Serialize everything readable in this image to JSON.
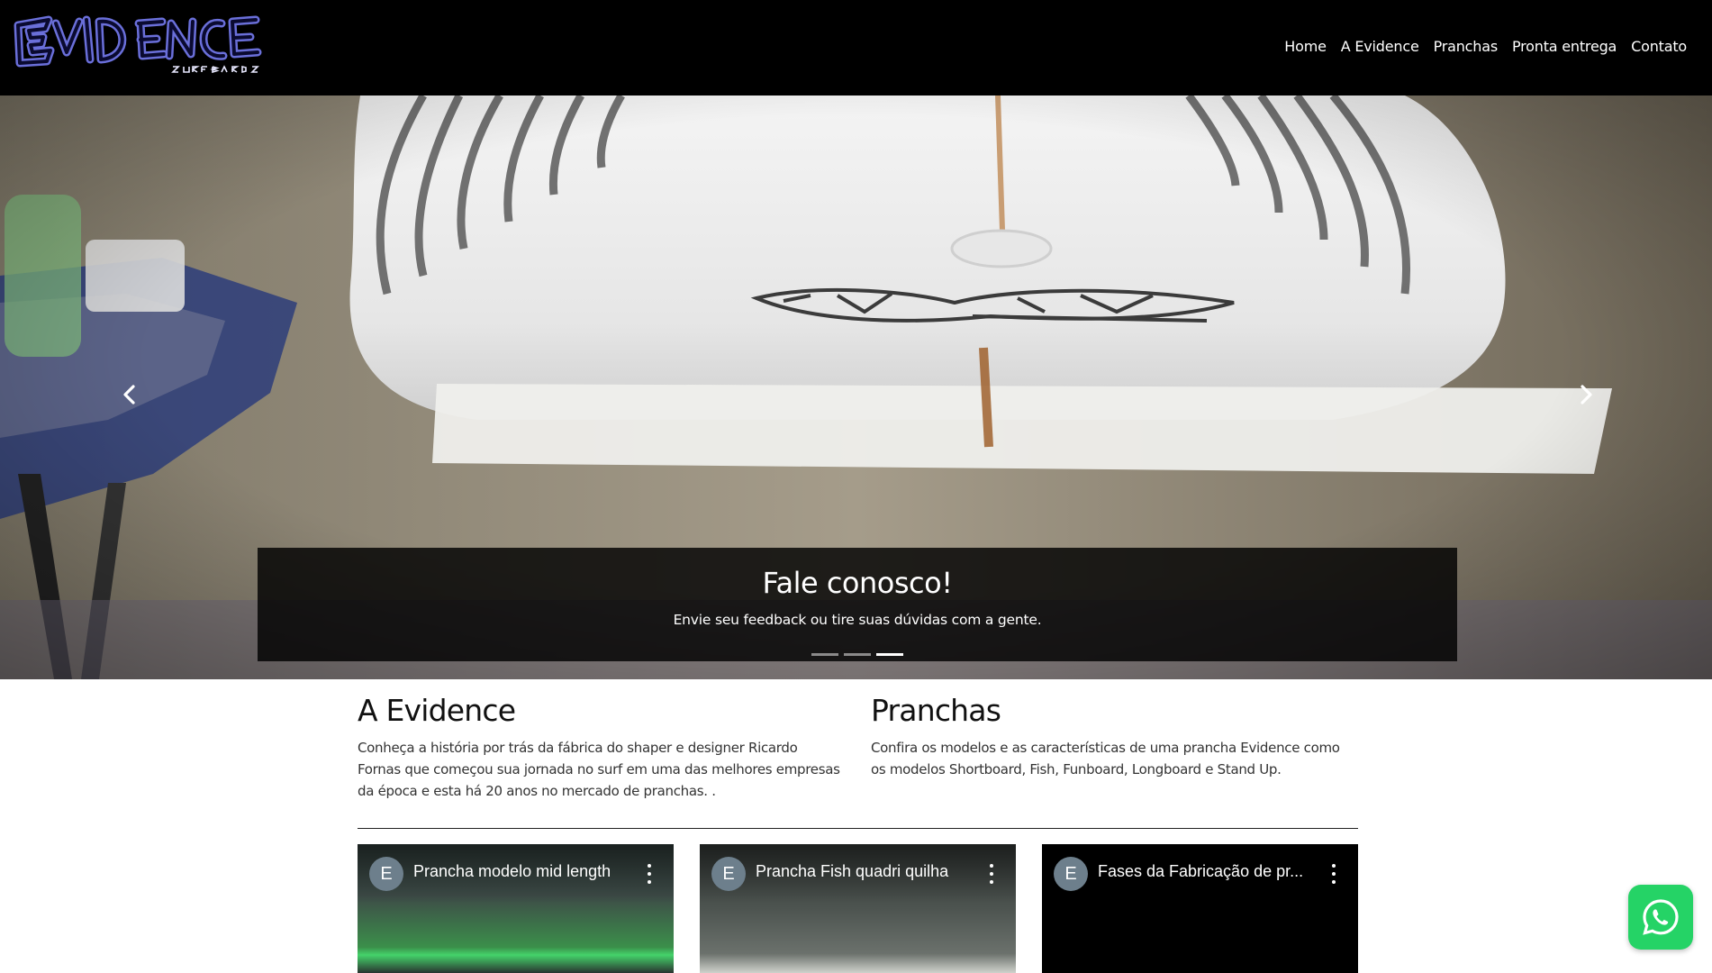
{
  "brand": {
    "logo_name": "Evidence Surfboards logo"
  },
  "nav": {
    "items": [
      {
        "label": "Home"
      },
      {
        "label": "A Evidence"
      },
      {
        "label": "Pranchas"
      },
      {
        "label": "Pronta entrega"
      },
      {
        "label": "Contato"
      }
    ]
  },
  "carousel": {
    "caption_title": "Fale conosco!",
    "caption_text": "Envie seu feedback ou tire suas dúvidas com a gente.",
    "slide_count": 3,
    "active_slide": 3,
    "prev_icon": "chevron-left-icon",
    "next_icon": "chevron-right-icon"
  },
  "sections": {
    "about": {
      "title": "A Evidence",
      "text": "Conheça a história por trás da fábrica do shaper e designer Ricardo Fornas que começou sua jornada no surf em uma das melhores empresas da época e esta há 20 anos no mercado de pranchas. ."
    },
    "boards": {
      "title": "Pranchas",
      "text": "Confira os modelos e as características de uma prancha Evidence como os modelos Shortboard, Fish, Funboard, Longboard e Stand Up."
    }
  },
  "videos": [
    {
      "avatar": "E",
      "title": "Prancha modelo mid length"
    },
    {
      "avatar": "E",
      "title": "Prancha Fish quadri quilha"
    },
    {
      "avatar": "E",
      "title": "Fases da Fabricação de pr..."
    }
  ],
  "whatsapp": {
    "icon": "whatsapp-icon"
  },
  "colors": {
    "navbar": "#000000",
    "whatsapp": "#25d366",
    "caption_bg": "#000000"
  }
}
